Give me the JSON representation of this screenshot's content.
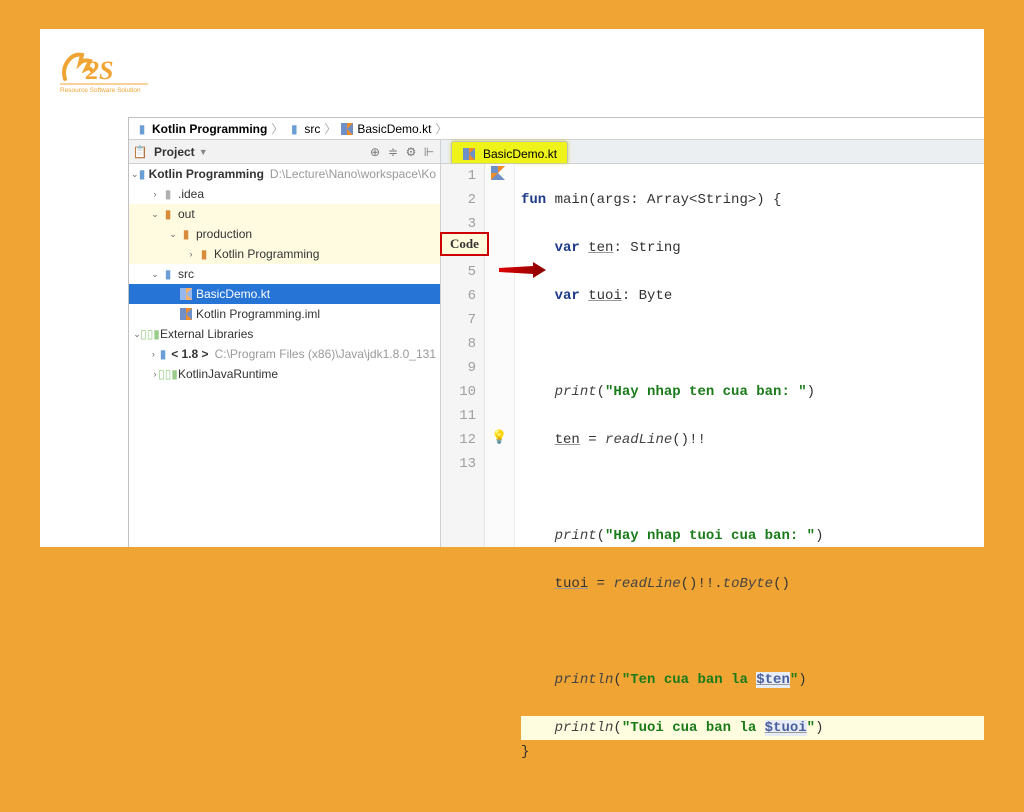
{
  "logo": {
    "text": "R2S",
    "tagline": "Resource Software Solution"
  },
  "breadcrumb": [
    {
      "icon": "folder-blue",
      "label": "Kotlin Programming"
    },
    {
      "icon": "folder-blue",
      "label": "src"
    },
    {
      "icon": "kt",
      "label": "BasicDemo.kt"
    }
  ],
  "project_header": {
    "title": "Project"
  },
  "tree": [
    {
      "indent": 0,
      "exp": "v",
      "icon": "folder-blue",
      "label": "Kotlin Programming",
      "suffix": "D:\\Lecture\\Nano\\workspace\\Ko",
      "hl": false
    },
    {
      "indent": 1,
      "exp": ">",
      "icon": "folder-grey",
      "label": ".idea"
    },
    {
      "indent": 1,
      "exp": "v",
      "icon": "folder-orange",
      "label": "out",
      "hl": true
    },
    {
      "indent": 2,
      "exp": "v",
      "icon": "folder-orange",
      "label": "production",
      "hl": true
    },
    {
      "indent": 3,
      "exp": ">",
      "icon": "folder-orange",
      "label": "Kotlin Programming",
      "hl": true
    },
    {
      "indent": 1,
      "exp": "v",
      "icon": "folder-blue",
      "label": "src"
    },
    {
      "indent": 2,
      "exp": "",
      "icon": "kt",
      "label": "BasicDemo.kt",
      "sel": true
    },
    {
      "indent": 2,
      "exp": "",
      "icon": "kt",
      "label": "Kotlin Programming.iml"
    },
    {
      "indent": 0,
      "exp": "v",
      "icon": "lib",
      "label": "External Libraries"
    },
    {
      "indent": 1,
      "exp": ">",
      "icon": "folder-blue",
      "label": "< 1.8 >",
      "suffix": "C:\\Program Files (x86)\\Java\\jdk1.8.0_131"
    },
    {
      "indent": 1,
      "exp": ">",
      "icon": "lib",
      "label": "KotlinJavaRuntime"
    }
  ],
  "tab": {
    "label": "BasicDemo.kt"
  },
  "badge": {
    "label": "Code"
  },
  "code_lines": 13,
  "code": {
    "l1": {
      "fun": "fun",
      "sig": " main(args: Array<String>) {"
    },
    "l2": {
      "var": "var",
      "name": "ten",
      "rest": ": String"
    },
    "l3": {
      "var": "var",
      "name": "tuoi",
      "rest": ": Byte"
    },
    "l5": {
      "call": "print",
      "open": "(",
      "str": "\"Hay nhap ten cua ban: \"",
      "close": ")"
    },
    "l6": {
      "name": "ten",
      "eq": " = ",
      "call": "readLine",
      "suffix": "()!!"
    },
    "l8": {
      "call": "print",
      "open": "(",
      "str": "\"Hay nhap tuoi cua ban: \"",
      "close": ")"
    },
    "l9": {
      "name": "tuoi",
      "eq": " = ",
      "call": "readLine",
      "suffix": "()!!.",
      "m": "toByte",
      "end": "()"
    },
    "l11": {
      "call": "println",
      "open": "(",
      "str1": "\"Ten cua ban la ",
      "tmpl": "$ten",
      "str2": "\"",
      "close": ")"
    },
    "l12": {
      "call": "println",
      "open": "(",
      "str1": "\"Tuoi cua ban la ",
      "tmpl": "$tuoi",
      "str2": "\"",
      "close": ")"
    },
    "l13": "}"
  }
}
